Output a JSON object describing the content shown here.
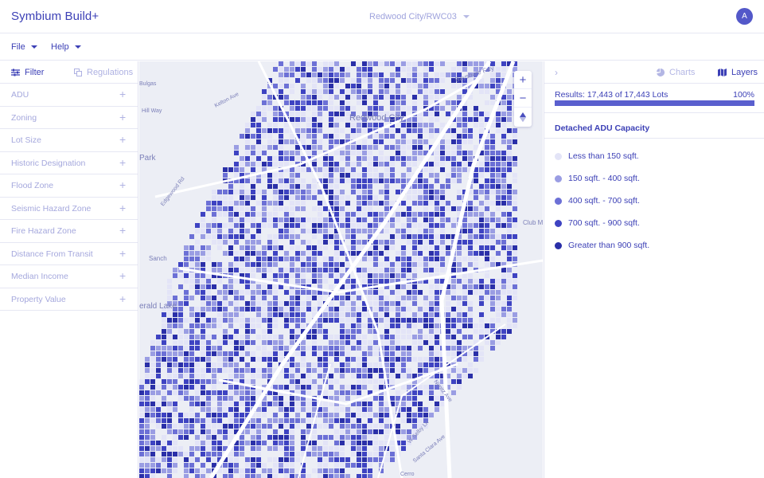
{
  "app": {
    "title": "Symbium Build+",
    "project": "Redwood City/RWC03",
    "avatar_initial": "A"
  },
  "menus": [
    {
      "label": "File"
    },
    {
      "label": "Help"
    }
  ],
  "left_panel": {
    "filter_tab": "Filter",
    "regulations_tab": "Regulations",
    "filters": [
      {
        "label": "ADU"
      },
      {
        "label": "Zoning"
      },
      {
        "label": "Lot Size"
      },
      {
        "label": "Historic Designation"
      },
      {
        "label": "Flood Zone"
      },
      {
        "label": "Seismic Hazard Zone"
      },
      {
        "label": "Fire Hazard Zone"
      },
      {
        "label": "Distance From Transit"
      },
      {
        "label": "Median Income"
      },
      {
        "label": "Property Value"
      }
    ]
  },
  "map": {
    "labels": [
      {
        "text": "Redwood City"
      },
      {
        "text": "Bayshore Fwy"
      },
      {
        "text": "Kelton Ave"
      },
      {
        "text": "Hill Way"
      },
      {
        "text": "Park"
      },
      {
        "text": "Edgewood Rd"
      },
      {
        "text": "Sanch"
      },
      {
        "text": "erald Lake"
      },
      {
        "text": "Club M"
      },
      {
        "text": "Nimitz Ave"
      },
      {
        "text": "W Selby Ln"
      },
      {
        "text": "Santa Clara Ave"
      },
      {
        "text": "Cerro"
      },
      {
        "text": "Bulgas"
      }
    ],
    "zoom_in": "+",
    "zoom_out": "−"
  },
  "right_panel": {
    "charts_tab": "Charts",
    "layers_tab": "Layers",
    "results_text": "Results: 17,443 of 17,443 Lots",
    "results_percent": "100%",
    "results_fraction": 1.0,
    "legend_title": "Detached ADU Capacity",
    "legend": [
      {
        "label": "Less than 150 sqft.",
        "color": "#e3e4f7"
      },
      {
        "label": "150 sqft. - 400 sqft.",
        "color": "#9a9de3"
      },
      {
        "label": "400 sqft. - 700 sqft.",
        "color": "#6c70d6"
      },
      {
        "label": "700 sqft. - 900 sqft.",
        "color": "#3e43c2"
      },
      {
        "label": "Greater than 900 sqft.",
        "color": "#2a2fa8"
      }
    ]
  },
  "colors": {
    "accent": "#3c40b6",
    "muted": "#a5a8dd"
  }
}
